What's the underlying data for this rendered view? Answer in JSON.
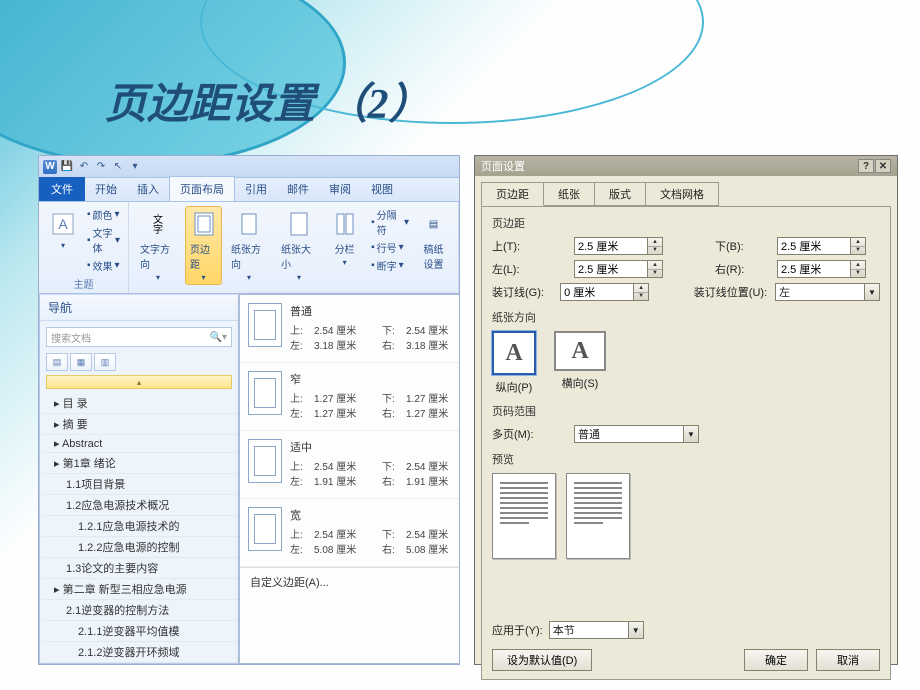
{
  "slide_title": "页边距设置 （2）",
  "word": {
    "tabs": {
      "file": "文件",
      "home": "开始",
      "insert": "插入",
      "pagelayout": "页面布局",
      "references": "引用",
      "mail": "邮件",
      "review": "审阅",
      "view": "视图"
    },
    "groups": {
      "theme": {
        "label": "主题",
        "color": "颜色",
        "font": "文字体",
        "effect": "效果"
      },
      "pagesetup": {
        "textdir": "文字方向",
        "margins": "页边距",
        "orient": "纸张方向",
        "size": "纸张大小",
        "cols": "分栏",
        "breaks": "分隔符",
        "lineno": "行号",
        "hyphen": "断字",
        "settings": "稿纸\n设置"
      }
    },
    "nav": {
      "title": "导航",
      "search_placeholder": "搜索文档",
      "items": [
        {
          "t": "目 录",
          "lv": 1
        },
        {
          "t": "摘 要",
          "lv": 1
        },
        {
          "t": "Abstract",
          "lv": 1
        },
        {
          "t": "第1章 绪论",
          "lv": 1
        },
        {
          "t": "1.1项目背景",
          "lv": 2
        },
        {
          "t": "1.2应急电源技术概况",
          "lv": 2
        },
        {
          "t": "1.2.1应急电源技术的",
          "lv": 3
        },
        {
          "t": "1.2.2应急电源的控制",
          "lv": 3
        },
        {
          "t": "1.3论文的主要内容",
          "lv": 2
        },
        {
          "t": "第二章 新型三相应急电源",
          "lv": 1
        },
        {
          "t": "2.1逆变器的控制方法",
          "lv": 2
        },
        {
          "t": "2.1.1逆变器平均值模",
          "lv": 3
        },
        {
          "t": "2.1.2逆变器开环频域",
          "lv": 3
        }
      ]
    },
    "margins_dd": {
      "presets": [
        {
          "name": "普通",
          "t": "2.54",
          "b": "2.54",
          "l": "3.18",
          "r": "3.18"
        },
        {
          "name": "窄",
          "t": "1.27",
          "b": "1.27",
          "l": "1.27",
          "r": "1.27"
        },
        {
          "name": "适中",
          "t": "2.54",
          "b": "2.54",
          "l": "1.91",
          "r": "1.91"
        },
        {
          "name": "宽",
          "t": "2.54",
          "b": "2.54",
          "l": "5.08",
          "r": "5.08"
        }
      ],
      "unit": "厘米",
      "top_l": "上:",
      "bot_l": "下:",
      "left_l": "左:",
      "right_l": "右:",
      "custom": "自定义边距(A)..."
    }
  },
  "dlg": {
    "title": "页面设置",
    "tabs": {
      "margins": "页边距",
      "paper": "纸张",
      "layout": "版式",
      "grid": "文档网格"
    },
    "sec_margins": "页边距",
    "labels": {
      "top": "上(T):",
      "bottom": "下(B):",
      "left": "左(L):",
      "right": "右(R):",
      "gutter": "装订线(G):",
      "gutterpos": "装订线位置(U):"
    },
    "vals": {
      "top": "2.5 厘米",
      "bottom": "2.5 厘米",
      "left": "2.5 厘米",
      "right": "2.5 厘米",
      "gutter": "0 厘米",
      "gutterpos": "左"
    },
    "sec_orient": "纸张方向",
    "orient": {
      "portrait": "纵向(P)",
      "landscape": "横向(S)"
    },
    "sec_pages": "页码范围",
    "multipage_l": "多页(M):",
    "multipage_v": "普通",
    "sec_preview": "预览",
    "applyto_l": "应用于(Y):",
    "applyto_v": "本节",
    "default": "设为默认值(D)",
    "ok": "确定",
    "cancel": "取消"
  }
}
